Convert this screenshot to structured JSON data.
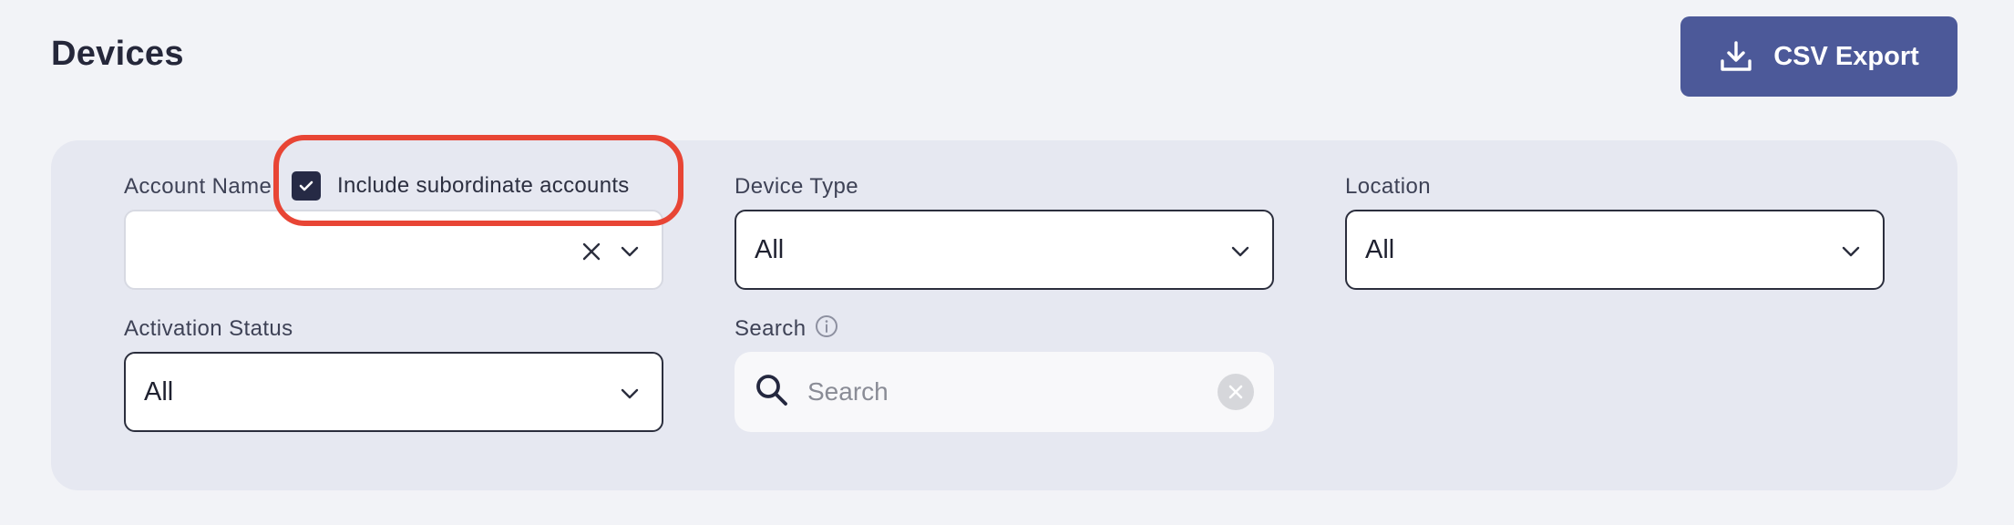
{
  "header": {
    "title": "Devices",
    "export_label": "CSV Export",
    "export_icon": "download-icon"
  },
  "filters": {
    "account_name": {
      "label": "Account Name",
      "value": "",
      "clear_icon": "close-icon",
      "dropdown_icon": "chevron-down-icon"
    },
    "include_subordinate": {
      "label": "Include subordinate accounts",
      "checked": true
    },
    "device_type": {
      "label": "Device Type",
      "value": "All"
    },
    "location": {
      "label": "Location",
      "value": "All"
    },
    "activation_status": {
      "label": "Activation Status",
      "value": "All"
    },
    "search": {
      "label": "Search",
      "info_icon": "info-icon",
      "placeholder": "Search",
      "value": ""
    }
  },
  "colors": {
    "background": "#f2f3f7",
    "panel": "#e6e8f1",
    "accent": "#4c5999",
    "checkbox": "#262a45",
    "highlight": "#e84535"
  }
}
